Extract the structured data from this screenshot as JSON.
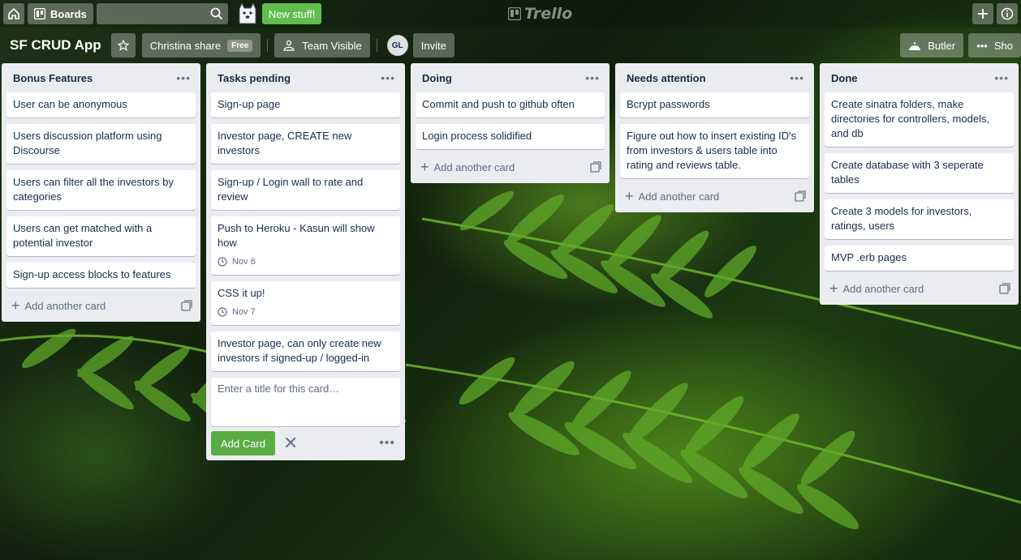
{
  "header": {
    "home_icon": "home-icon",
    "boards_label": "Boards",
    "search": {
      "value": "",
      "placeholder": ""
    },
    "new_stuff_label": "New stuff!",
    "logo_text": "Trello",
    "add_icon": "plus-icon",
    "info_icon": "info-icon"
  },
  "board": {
    "title": "SF CRUD App",
    "team_name": "Christina share",
    "team_badge": "Free",
    "visibility_label": "Team Visible",
    "member_initials": "GL",
    "invite_label": "Invite",
    "butler_label": "Butler",
    "show_menu_label": "Sho"
  },
  "lists": [
    {
      "title": "Bonus Features",
      "cards": [
        {
          "title": "User can be anonymous"
        },
        {
          "title": "Users discussion platform using Discourse"
        },
        {
          "title": "Users can filter all the investors by categories"
        },
        {
          "title": "Users can get matched with a potential investor"
        },
        {
          "title": "Sign-up access blocks to features"
        }
      ],
      "add_label": "Add another card"
    },
    {
      "title": "Tasks pending",
      "cards": [
        {
          "title": "Sign-up page"
        },
        {
          "title": "Investor page, CREATE new investors"
        },
        {
          "title": "Sign-up / Login wall to rate and review"
        },
        {
          "title": "Push to Heroku - Kasun will show how",
          "due": "Nov 6"
        },
        {
          "title": "CSS it up!",
          "due": "Nov 7"
        },
        {
          "title": "Investor page, can only create new investors if signed-up / logged-in"
        }
      ],
      "composer": {
        "placeholder": "Enter a title for this card…",
        "add_button": "Add Card"
      }
    },
    {
      "title": "Doing",
      "cards": [
        {
          "title": "Commit and push to github often"
        },
        {
          "title": "Login process solidified"
        }
      ],
      "add_label": "Add another card"
    },
    {
      "title": "Needs attention",
      "cards": [
        {
          "title": "Bcrypt passwords"
        },
        {
          "title": "Figure out how to insert existing ID's from investors & users table into rating and reviews table."
        }
      ],
      "add_label": "Add another card"
    },
    {
      "title": "Done",
      "cards": [
        {
          "title": "Create sinatra folders, make directories for controllers, models, and db"
        },
        {
          "title": "Create database with 3 seperate tables"
        },
        {
          "title": "Create 3 models for investors, ratings, users"
        },
        {
          "title": "MVP .erb pages"
        }
      ],
      "add_label": "Add another card"
    }
  ],
  "colors": {
    "list_bg": "#ebecf0",
    "accent_green": "#5aac44",
    "new_stuff_green": "#61bd4f"
  }
}
